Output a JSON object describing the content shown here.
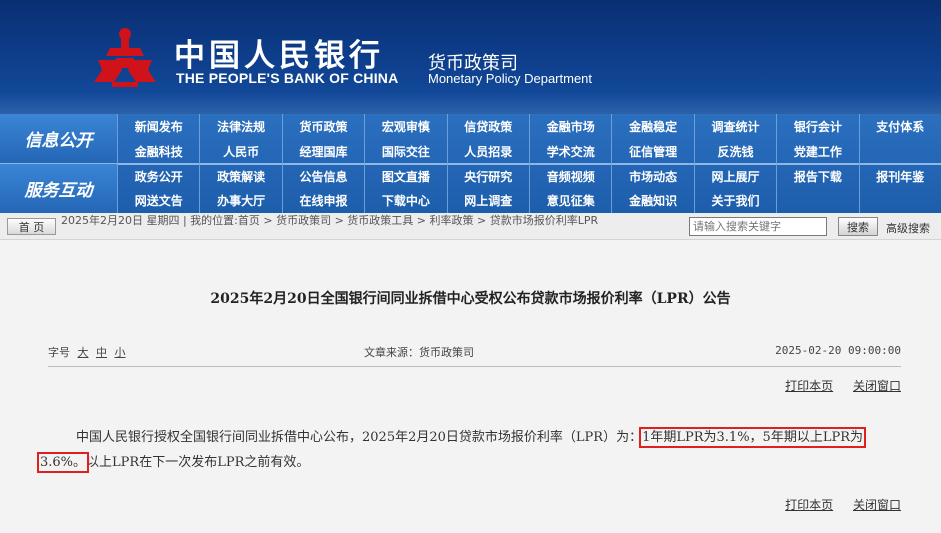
{
  "header": {
    "logo_cn": "中国人民银行",
    "logo_en": "THE PEOPLE'S BANK OF CHINA",
    "dept_cn": "货币政策司",
    "dept_en": "Monetary Policy Department",
    "colors": {
      "banner": "#0e3f8d",
      "emblem": "#d0121b"
    }
  },
  "nav": {
    "section1_label": "信息公开",
    "section2_label": "服务互动",
    "row1": [
      "新闻发布",
      "法律法规",
      "货币政策",
      "宏观审慎",
      "信贷政策",
      "金融市场",
      "金融稳定",
      "调查统计",
      "银行会计",
      "支付体系"
    ],
    "row2": [
      "金融科技",
      "人民币",
      "经理国库",
      "国际交往",
      "人员招录",
      "学术交流",
      "征信管理",
      "反洗钱",
      "党建工作",
      ""
    ],
    "row3": [
      "政务公开",
      "政策解读",
      "公告信息",
      "图文直播",
      "央行研究",
      "音频视频",
      "市场动态",
      "网上展厅",
      "报告下载",
      "报刊年鉴"
    ],
    "row4": [
      "网送文告",
      "办事大厅",
      "在线申报",
      "下载中心",
      "网上调查",
      "意见征集",
      "金融知识",
      "关于我们",
      "",
      ""
    ]
  },
  "crumb": {
    "home": "首 页",
    "text": "2025年2月20日 星期四 | 我的位置:首页  >  货币政策司  >  货币政策工具  >  利率政策  >  贷款市场报价利率LPR",
    "search_placeholder": "请输入搜索关键字",
    "search_button": "搜索",
    "advanced": "高级搜索"
  },
  "article": {
    "title": "2025年2月20日全国银行间同业拆借中心受权公布贷款市场报价利率（LPR）公告",
    "font_label": "字号",
    "font_large": "大",
    "font_medium": "中",
    "font_small": "小",
    "source": "文章来源：货币政策司",
    "datetime": "2025-02-20 09:00:00",
    "print": "打印本页",
    "close": "关闭窗口",
    "body_intro": "中国人民银行授权全国银行间同业拆借中心公布，2025年2月20日贷款市场报价利率（LPR）为：",
    "body_highlight_1": "1年期LPR为3.1%，5年期以上LPR为",
    "body_highlight_2": "3.6%。",
    "body_tail": "以上LPR在下一次发布LPR之前有效。"
  }
}
